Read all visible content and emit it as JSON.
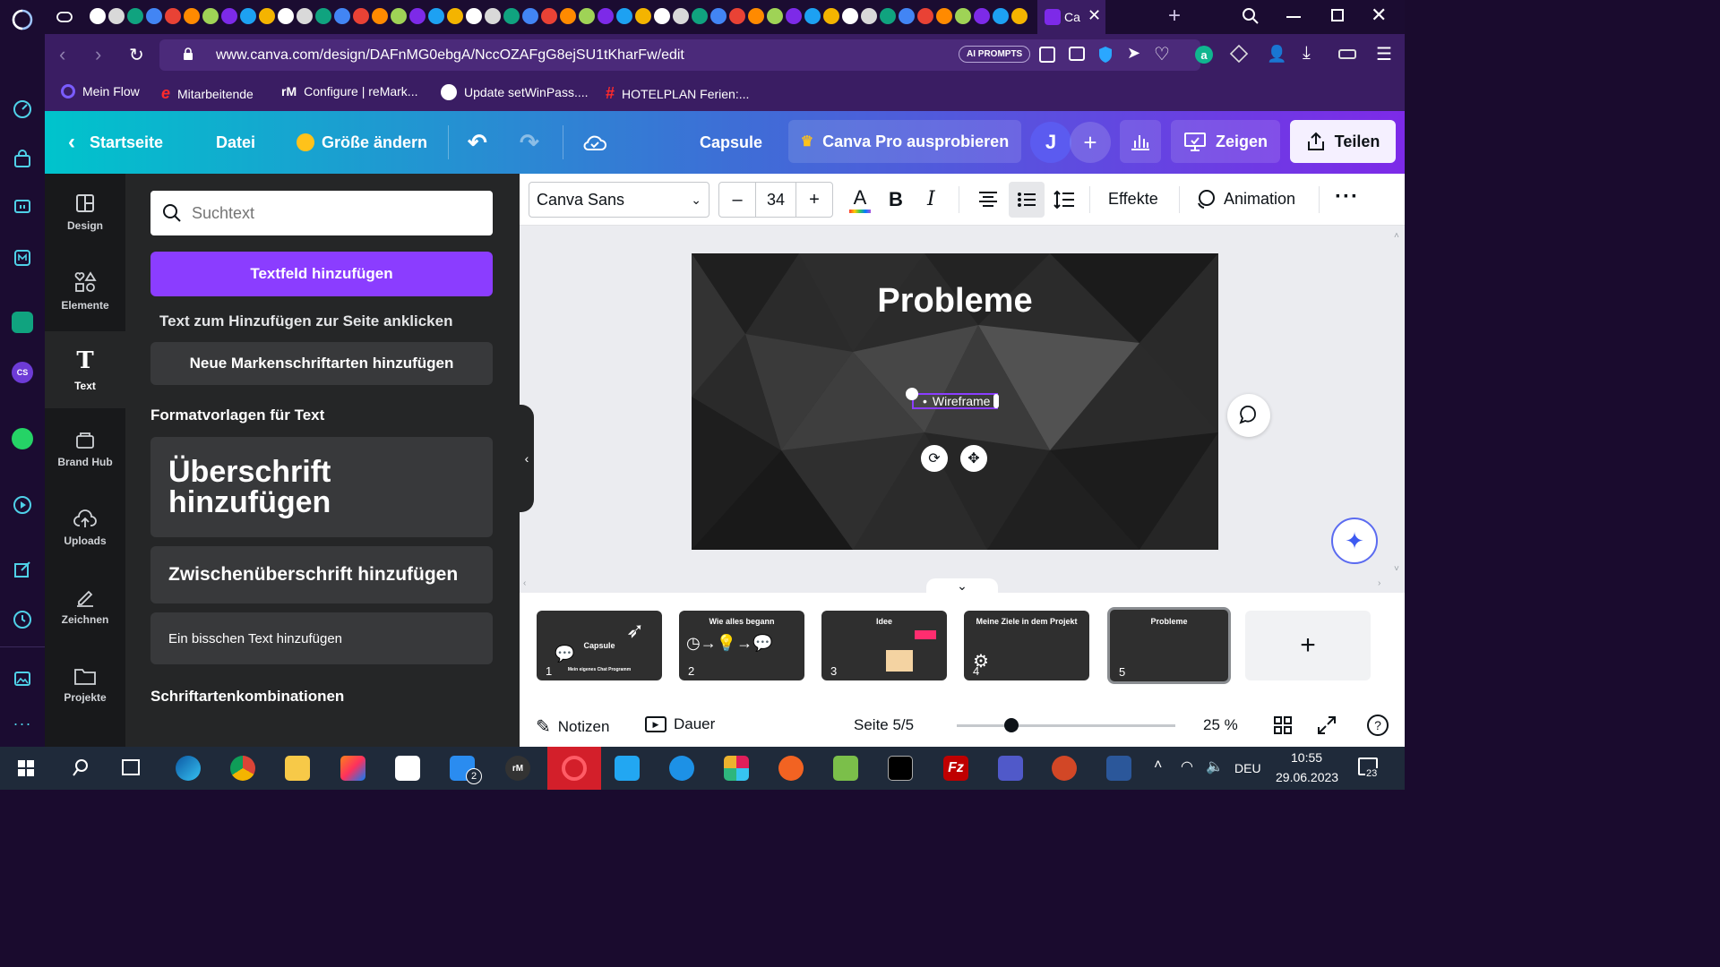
{
  "browser": {
    "active_tab_title": "Ca",
    "url": "www.canva.com/design/DAFnMG0ebgA/NccOZAFgG8ejSU1tKharFw/edit",
    "ai_prompts_label": "AI PROMPTS",
    "bookmarks": [
      {
        "label": "Mein Flow",
        "icon": "opera-flow-icon"
      },
      {
        "label": "Mitarbeitende",
        "icon": "e-logo-icon"
      },
      {
        "label": "Configure | reMark...",
        "icon": "remarkable-icon"
      },
      {
        "label": "Update setWinPass....",
        "icon": "github-icon"
      },
      {
        "label": "HOTELPLAN Ferien:...",
        "icon": "hashtag-icon"
      }
    ]
  },
  "canva_header": {
    "home_label": "Startseite",
    "file_label": "Datei",
    "resize_label": "Größe ändern",
    "design_title": "Capsule",
    "pro_label": "Canva Pro ausprobieren",
    "avatar_initial": "J",
    "present_label": "Zeigen",
    "share_label": "Teilen"
  },
  "left_rail": {
    "items": [
      {
        "label": "Design",
        "icon": "layout-icon"
      },
      {
        "label": "Elemente",
        "icon": "shapes-icon"
      },
      {
        "label": "Text",
        "icon": "text-icon"
      },
      {
        "label": "Brand Hub",
        "icon": "brand-icon"
      },
      {
        "label": "Uploads",
        "icon": "cloud-upload-icon"
      },
      {
        "label": "Zeichnen",
        "icon": "draw-icon"
      },
      {
        "label": "Projekte",
        "icon": "folder-icon"
      }
    ]
  },
  "text_panel": {
    "search_placeholder": "Suchtext",
    "add_textbox_label": "Textfeld hinzufügen",
    "hint": "Text zum Hinzufügen zur Seite anklicken",
    "brand_fonts_label": "Neue Markenschriftarten hinzufügen",
    "presets_heading": "Formatvorlagen für Text",
    "heading_preset": "Überschrift hinzufügen",
    "subheading_preset": "Zwischenüberschrift hinzufügen",
    "body_preset": "Ein bisschen Text hinzufügen",
    "combos_heading": "Schriftartenkombinationen"
  },
  "toolbar": {
    "font_name": "Canva Sans",
    "font_size": "34",
    "effects_label": "Effekte",
    "animation_label": "Animation"
  },
  "slide": {
    "title": "Probleme",
    "bullet_text": "Wireframe"
  },
  "pages": [
    {
      "num": "1",
      "title": "Capsule",
      "subtitle": "Mein eigenes Chat Programm"
    },
    {
      "num": "2",
      "title": "Wie alles begann",
      "subtitle": ""
    },
    {
      "num": "3",
      "title": "Idee",
      "subtitle": ""
    },
    {
      "num": "4",
      "title": "Meine Ziele in dem Projekt",
      "subtitle": ""
    },
    {
      "num": "5",
      "title": "Probleme",
      "subtitle": ""
    }
  ],
  "footer": {
    "notes_label": "Notizen",
    "duration_label": "Dauer",
    "page_indicator": "Seite 5/5",
    "zoom_label": "25 %",
    "zoom_fraction": 0.25
  },
  "taskbar": {
    "language": "DEU",
    "time": "10:55",
    "date": "29.06.2023",
    "notification_count": "23",
    "badge_count": "2"
  },
  "colors": {
    "canva_gradient_start": "#00c4cc",
    "canva_gradient_end": "#7d2ae8",
    "primary_button": "#8b3dff",
    "opera_bg": "#1b0c31",
    "browser_bar": "#3a1d63"
  }
}
